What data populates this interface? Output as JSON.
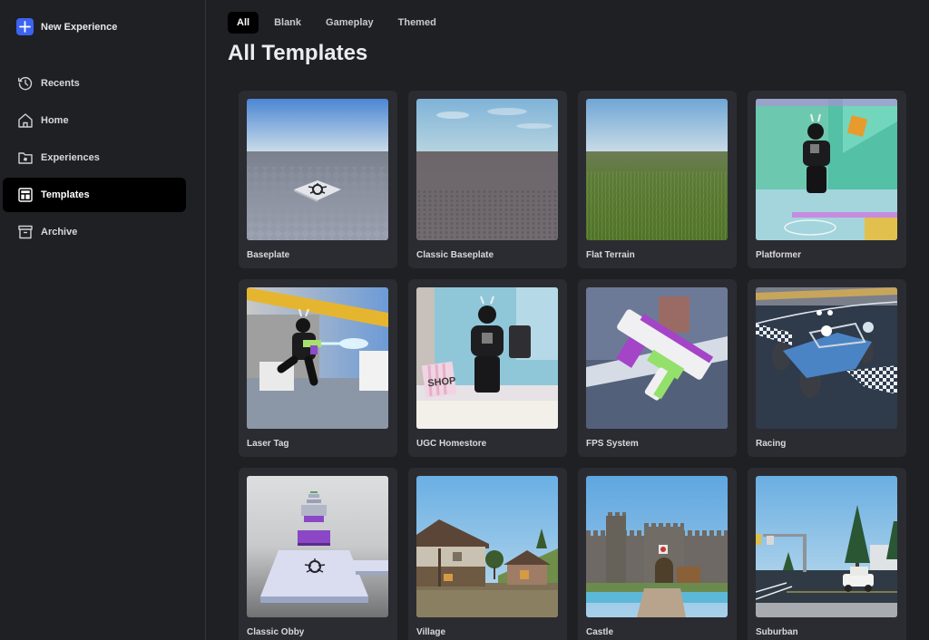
{
  "sidebar": {
    "new_experience": {
      "label": "New Experience",
      "icon": "plus-icon",
      "color": "#3d63f2"
    },
    "items": [
      {
        "label": "Recents",
        "icon": "history-icon",
        "active": false
      },
      {
        "label": "Home",
        "icon": "home-icon",
        "active": false
      },
      {
        "label": "Experiences",
        "icon": "folder-icon",
        "active": false
      },
      {
        "label": "Templates",
        "icon": "templates-icon",
        "active": true
      },
      {
        "label": "Archive",
        "icon": "archive-icon",
        "active": false
      }
    ]
  },
  "main": {
    "tabs": [
      {
        "label": "All",
        "active": true
      },
      {
        "label": "Blank",
        "active": false
      },
      {
        "label": "Gameplay",
        "active": false
      },
      {
        "label": "Themed",
        "active": false
      }
    ],
    "title": "All Templates",
    "templates": [
      {
        "name": "Baseplate",
        "thumb": "baseplate"
      },
      {
        "name": "Classic Baseplate",
        "thumb": "classic-baseplate"
      },
      {
        "name": "Flat Terrain",
        "thumb": "flat-terrain"
      },
      {
        "name": "Platformer",
        "thumb": "platformer"
      },
      {
        "name": "Laser Tag",
        "thumb": "laser-tag"
      },
      {
        "name": "UGC Homestore",
        "thumb": "ugc-homestore",
        "sign_text": "SHOP"
      },
      {
        "name": "FPS System",
        "thumb": "fps-system"
      },
      {
        "name": "Racing",
        "thumb": "racing"
      },
      {
        "name": "Classic Obby",
        "thumb": "classic-obby"
      },
      {
        "name": "Village",
        "thumb": "village"
      },
      {
        "name": "Castle",
        "thumb": "castle"
      },
      {
        "name": "Suburban",
        "thumb": "suburban"
      }
    ]
  }
}
